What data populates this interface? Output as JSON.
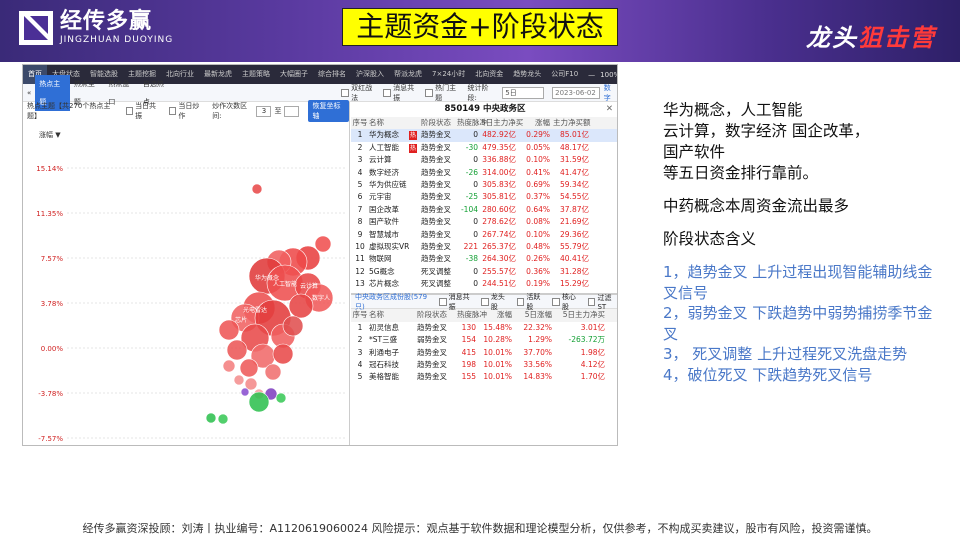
{
  "header": {
    "logo_cn": "经传多赢",
    "logo_en": "JINGZHUAN DUOYING",
    "title": "主题资金+阶段状态",
    "brand_right_a": "龙头",
    "brand_right_b": "狙击营"
  },
  "app": {
    "tabs": [
      "首页",
      "大盘状态",
      "智能选股",
      "主题挖掘",
      "北向行业",
      "最新龙虎",
      "主题策略",
      "大幅圈子",
      "综合排名",
      "沪深股入",
      "帮派龙虎",
      "7×24小时",
      "北向资金",
      "趋势龙头",
      "公司F10"
    ],
    "tab_right": [
      "—",
      "100%",
      "+",
      "⚙",
      "▣",
      "✕"
    ],
    "subtabs": [
      "热点主题",
      "热点主题",
      "热点盘口",
      "自选热点"
    ],
    "checkboxes_top": [
      "双红战法",
      "消息共振",
      "热门主题"
    ],
    "filter_label": "统计阶段:",
    "filter_value": "5日",
    "date_placeholder": "2023-06-02",
    "link_right": "数字",
    "bubble_head": {
      "title": "热点主题【共270个热点主题】",
      "chk1": "当日共振",
      "chk2": "当日炒作",
      "freq_label": "炒作次数区间:",
      "freq_from": "3",
      "freq_to_label": "至",
      "reset": "恢复坐标轴"
    },
    "bubble_sort": "涨幅 ▼",
    "table_title": "850149 中央政务区",
    "table_close": "✕",
    "table_headers": [
      "序号",
      "名称",
      "",
      "阶段状态",
      "热度脉冲",
      "5日主力净买",
      "涨幅",
      "主力净买额"
    ],
    "rows": [
      {
        "seq": "1",
        "name": "华为概念",
        "flag": "热",
        "stage": "趋势金叉",
        "pulse": "0",
        "net5": "482.92亿",
        "chg": "0.29%",
        "main": "85.01亿"
      },
      {
        "seq": "2",
        "name": "人工智能",
        "flag": "热",
        "stage": "趋势金叉",
        "pulse": "-30",
        "net5": "479.35亿",
        "chg": "0.05%",
        "main": "48.17亿"
      },
      {
        "seq": "3",
        "name": "云计算",
        "flag": "",
        "stage": "趋势金叉",
        "pulse": "0",
        "net5": "336.88亿",
        "chg": "0.10%",
        "main": "31.59亿"
      },
      {
        "seq": "4",
        "name": "数字经济",
        "flag": "",
        "stage": "趋势金叉",
        "pulse": "-26",
        "net5": "314.00亿",
        "chg": "0.41%",
        "main": "41.47亿"
      },
      {
        "seq": "5",
        "name": "华为供应链",
        "flag": "",
        "stage": "趋势金叉",
        "pulse": "0",
        "net5": "305.83亿",
        "chg": "0.69%",
        "main": "59.34亿"
      },
      {
        "seq": "6",
        "name": "元宇宙",
        "flag": "",
        "stage": "趋势金叉",
        "pulse": "-25",
        "net5": "305.81亿",
        "chg": "0.37%",
        "main": "54.55亿"
      },
      {
        "seq": "7",
        "name": "国企改革",
        "flag": "",
        "stage": "趋势金叉",
        "pulse": "-104",
        "net5": "280.60亿",
        "chg": "0.64%",
        "main": "37.87亿"
      },
      {
        "seq": "8",
        "name": "国产软件",
        "flag": "",
        "stage": "趋势金叉",
        "pulse": "0",
        "net5": "278.62亿",
        "chg": "0.08%",
        "main": "21.69亿"
      },
      {
        "seq": "9",
        "name": "智慧城市",
        "flag": "",
        "stage": "趋势金叉",
        "pulse": "0",
        "net5": "267.74亿",
        "chg": "0.10%",
        "main": "29.36亿"
      },
      {
        "seq": "10",
        "name": "虚拟现实VR",
        "flag": "",
        "stage": "趋势金叉",
        "pulse": "221",
        "net5": "265.37亿",
        "chg": "0.48%",
        "main": "55.79亿"
      },
      {
        "seq": "11",
        "name": "物联网",
        "flag": "",
        "stage": "趋势金叉",
        "pulse": "-38",
        "net5": "264.30亿",
        "chg": "0.26%",
        "main": "40.41亿"
      },
      {
        "seq": "12",
        "name": "5G概念",
        "flag": "",
        "stage": "死叉调整",
        "pulse": "0",
        "net5": "255.57亿",
        "chg": "0.36%",
        "main": "31.28亿"
      },
      {
        "seq": "13",
        "name": "芯片概念",
        "flag": "",
        "stage": "死叉调整",
        "pulse": "0",
        "net5": "244.51亿",
        "chg": "0.19%",
        "main": "15.29亿"
      }
    ],
    "sub_bar_lead": "中央政务区成份股(579只)",
    "sub_checks": [
      "消息共振",
      "龙头股",
      "活跃股",
      "核心股",
      "过滤ST"
    ],
    "sub_headers": [
      "序号",
      "名称",
      "阶段状态",
      "热度脉冲",
      "涨幅",
      "5日涨幅",
      "5日主力净买"
    ],
    "sub_rows": [
      {
        "seq": "1",
        "name": "初灵信息",
        "stage": "趋势金叉",
        "pulse": "130",
        "chg": "15.48%",
        "chg5": "22.32%",
        "net": "3.01亿"
      },
      {
        "seq": "2",
        "name": "*ST三盛",
        "stage": "弱势金叉",
        "pulse": "154",
        "chg": "10.28%",
        "chg5": "1.29%",
        "net": "-263.72万"
      },
      {
        "seq": "3",
        "name": "利通电子",
        "stage": "趋势金叉",
        "pulse": "415",
        "chg": "10.01%",
        "chg5": "37.70%",
        "net": "1.98亿"
      },
      {
        "seq": "4",
        "name": "冠石科技",
        "stage": "趋势金叉",
        "pulse": "198",
        "chg": "10.01%",
        "chg5": "33.56%",
        "net": "4.12亿"
      },
      {
        "seq": "5",
        "name": "美格智能",
        "stage": "趋势金叉",
        "pulse": "155",
        "chg": "10.01%",
        "chg5": "14.83%",
        "net": "1.70亿"
      }
    ]
  },
  "chart_data": {
    "type": "scatter",
    "y_ticks": [
      "15.14%",
      "11.35%",
      "7.57%",
      "3.78%",
      "0.00%",
      "-3.78%",
      "-7.57%"
    ],
    "ylim": [
      -7.57,
      15.14
    ],
    "labels": [
      "华为概念",
      "人工智能",
      "云计算",
      "数字人",
      "光电雷达",
      "芯片"
    ]
  },
  "commentary": {
    "p1": [
      "华为概念，人工智能",
      "云计算，数字经济  国企改革，",
      "国产软件",
      "等五日资金排行靠前。"
    ],
    "p2": "中药概念本周资金流出最多",
    "p3": "阶段状态含义",
    "items": [
      "1，趋势金叉  上升过程出现智能辅助线金叉信号",
      "2，弱势金叉   下跌趋势中弱势捕捞季节金叉",
      "3，  死叉调整  上升过程死叉洗盘走势",
      "4，破位死叉   下跌趋势死叉信号"
    ]
  },
  "footer": "经传多赢资深投顾：刘涛丨执业编号：A1120619060024   风险提示：观点基于软件数据和理论模型分析，仅供参考，不构成买卖建议，股市有风险，投资需谨慎。",
  "colors": {
    "accent": "#2f6fd6",
    "up": "#e02020",
    "down": "#14a035",
    "title_bg": "#ffff00"
  }
}
